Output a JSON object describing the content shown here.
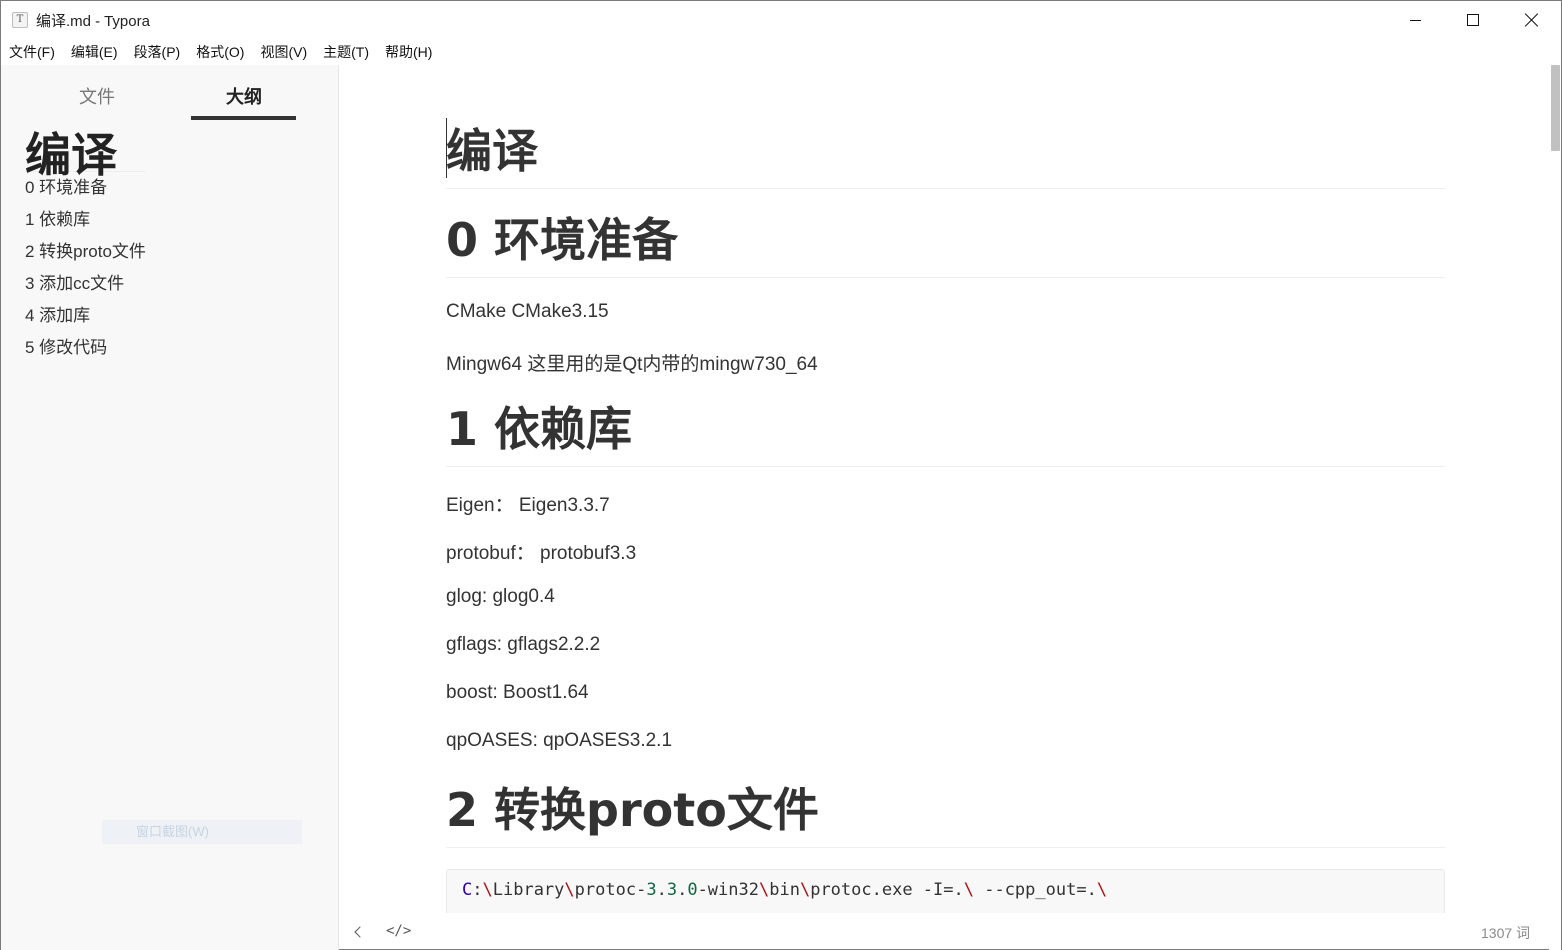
{
  "window": {
    "title": "编译.md - Typora",
    "app_icon_letter": "T"
  },
  "menu": [
    "文件(F)",
    "编辑(E)",
    "段落(P)",
    "格式(O)",
    "视图(V)",
    "主题(T)",
    "帮助(H)"
  ],
  "sidebar": {
    "tabs": [
      {
        "label": "文件",
        "active": false
      },
      {
        "label": "大纲",
        "active": true
      }
    ],
    "outline": [
      "编译",
      "0 环境准备",
      "1 依赖库",
      "2 转换proto文件",
      "3 添加cc文件",
      "4 添加库",
      "5 修改代码"
    ],
    "ghost_tooltip": "窗口截图(W)"
  },
  "document": {
    "h1_title": "编译",
    "h1_env": "0 环境准备",
    "env_lines": [
      "CMake  CMake3.15",
      "Mingw64 这里用的是Qt内带的mingw730_64"
    ],
    "h1_deps": "1 依赖库",
    "deps_lines": [
      "Eigen：  Eigen3.3.7",
      "protobuf：  protobuf3.3",
      "glog:  glog0.4",
      "gflags: gflags2.2.2",
      "boost: Boost1.64",
      "qpOASES: qpOASES3.2.1"
    ],
    "h1_proto": "2 转换proto文件",
    "code_parts": {
      "drive": "C",
      "colon": ":",
      "bs": "\\",
      "library": "Library",
      "protoc": "protoc-",
      "v1": "3",
      "dot": ".",
      "v2": "3",
      "v3": "0",
      "win32": "-win32",
      "bin": "bin",
      "exe": "protoc.exe -I=.",
      "cppout": " --cpp_out=."
    }
  },
  "status": {
    "source_icon": "</>",
    "word_count": "1307 词"
  },
  "colors": {
    "sidebar_bg": "#f8f8f8",
    "text": "#333333",
    "code_bg": "#f8f8f8"
  }
}
